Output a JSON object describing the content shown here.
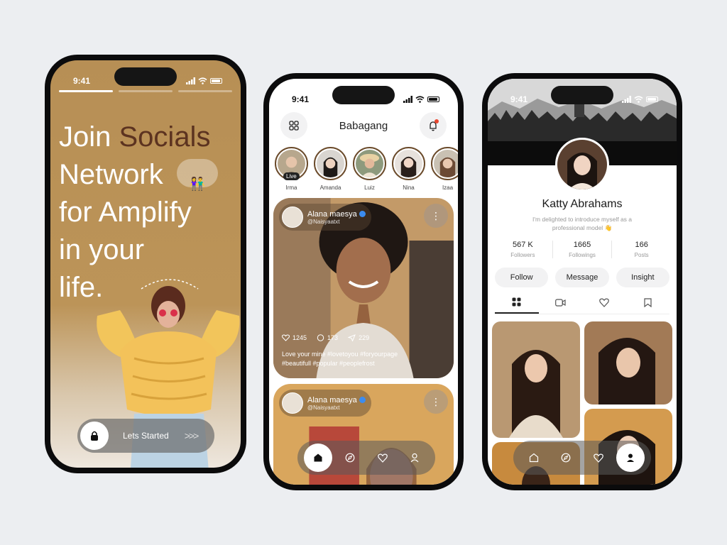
{
  "status": {
    "time": "9:41"
  },
  "onboarding": {
    "headline_part1": "Join ",
    "headline_accent": "Socials",
    "headline_line2": "Network",
    "headline_line3": "for Amplify",
    "headline_line4": "in your",
    "headline_line5": "life.",
    "cta_label": "Lets Started",
    "cta_arrows": ">>>"
  },
  "feed": {
    "title": "Babagang",
    "stories": [
      {
        "name": "Irma",
        "live": "Live"
      },
      {
        "name": "Amanda"
      },
      {
        "name": "Luiz"
      },
      {
        "name": "Nina"
      },
      {
        "name": "Izaa"
      }
    ],
    "post1": {
      "user": "Alana maesya",
      "handle": "@Naisyaatxt",
      "likes": "1245",
      "comments": "173",
      "shares": "229",
      "caption": "Love your mine  #lovetoyou #foryourpage #beautifull #popular #peoplefrost"
    },
    "post2": {
      "user": "Alana maesya",
      "handle": "@Naisyaatxt"
    }
  },
  "profile": {
    "name": "Katty Abrahams",
    "bio": "I'm delighted to introduce myself as a professional model 👋",
    "followers": "567 K",
    "followers_label": "Followers",
    "followings": "1665",
    "followings_label": "Followings",
    "posts": "166",
    "posts_label": "Posts",
    "follow": "Follow",
    "message": "Message",
    "insight": "Insight"
  }
}
